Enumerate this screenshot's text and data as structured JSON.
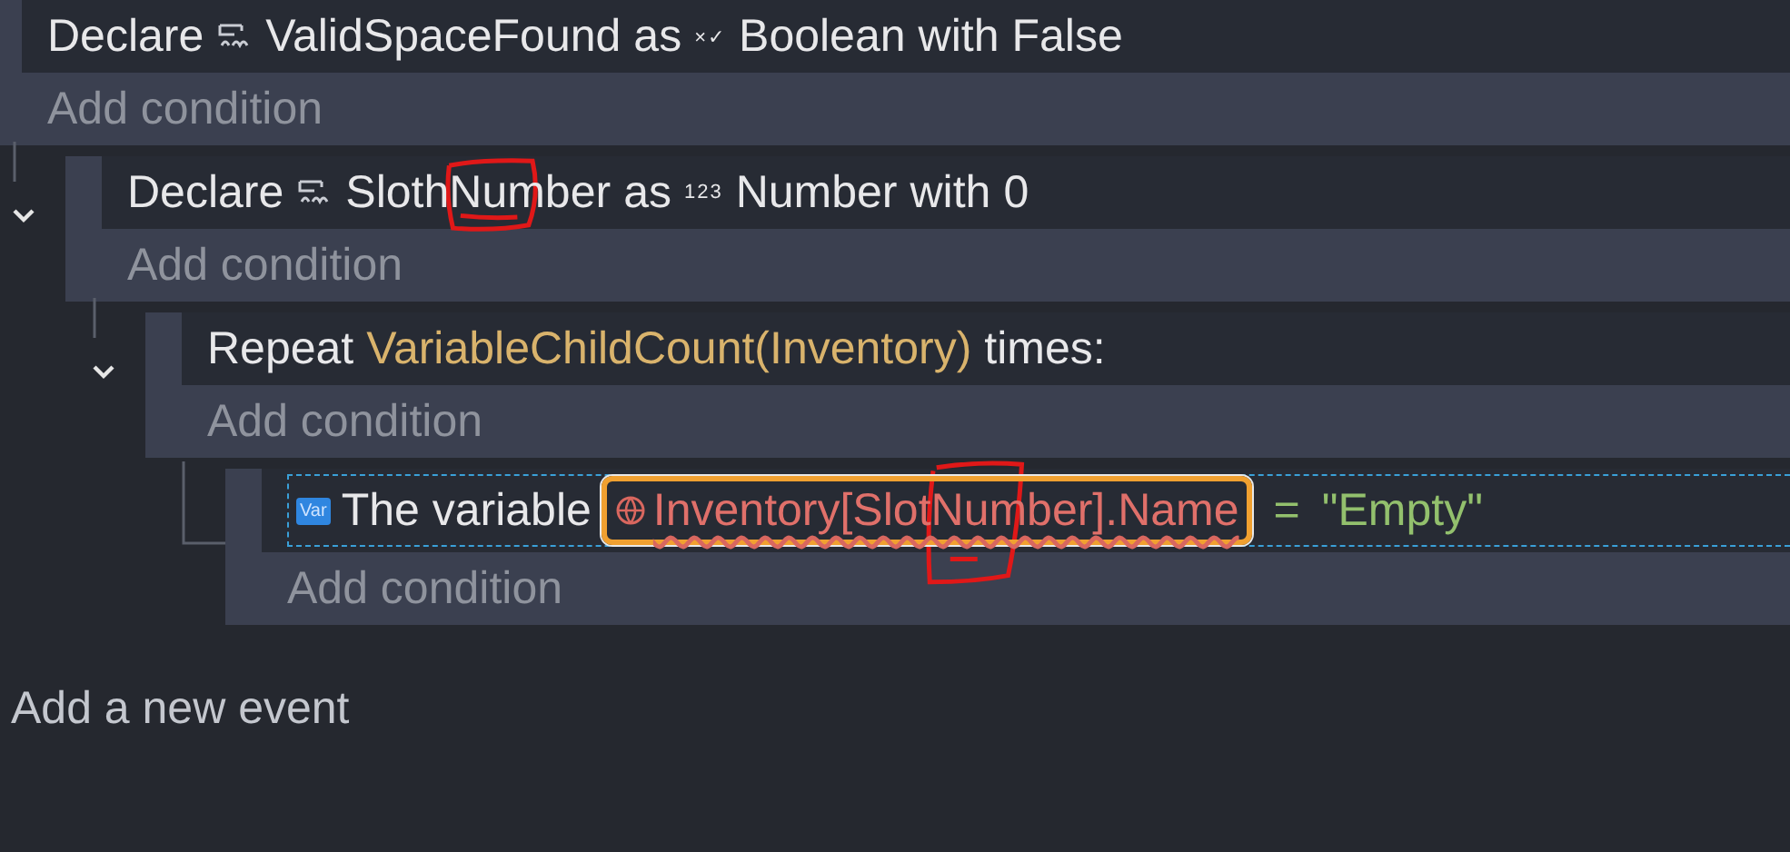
{
  "events": [
    {
      "kind": "declare",
      "keyword": "Declare",
      "variable": "ValidSpaceFound",
      "as": "as",
      "type_icon": "×✓",
      "type": "Boolean",
      "with": "with",
      "value": "False",
      "add_condition": "Add condition",
      "children": [
        {
          "kind": "declare",
          "keyword": "Declare",
          "variable": "SlothNumber",
          "annotated": true,
          "as": "as",
          "type_icon": "123",
          "type": "Number",
          "with": "with",
          "value": "0",
          "expanded": true,
          "add_condition": "Add condition",
          "children": [
            {
              "kind": "repeat",
              "keyword": "Repeat",
              "expression": "VariableChildCount(Inventory)",
              "suffix": "times:",
              "expanded": true,
              "add_condition": "Add condition",
              "children": [
                {
                  "kind": "instruction",
                  "badge": "Var",
                  "label": "The variable",
                  "field": {
                    "text": "Inventory[SlotNumber].Name",
                    "selected": true,
                    "error": true,
                    "annotated": true
                  },
                  "operator": "=",
                  "value": "\"Empty\"",
                  "add_condition": "Add condition"
                }
              ]
            }
          ]
        }
      ]
    }
  ],
  "add_event": "Add a new event"
}
